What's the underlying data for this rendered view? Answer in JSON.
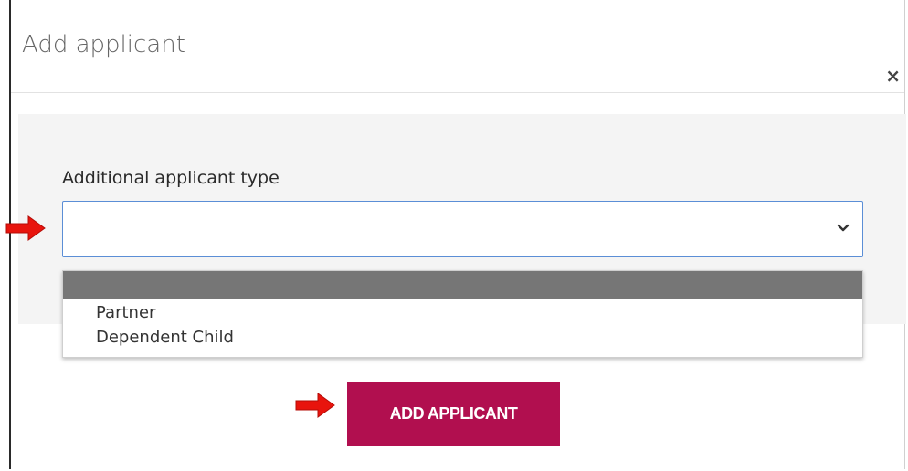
{
  "modal": {
    "title": "Add applicant",
    "close_symbol": "×"
  },
  "form": {
    "field_label": "Additional applicant type",
    "selected_value": "",
    "options": [
      {
        "label": "",
        "highlighted": true
      },
      {
        "label": "Partner",
        "highlighted": false
      },
      {
        "label": "Dependent Child",
        "highlighted": false
      }
    ]
  },
  "actions": {
    "add_label": "ADD APPLICANT"
  },
  "annotations": {
    "arrow_icon": "red-arrow-right-icon"
  },
  "colors": {
    "primary_button": "#b10f4f",
    "select_border": "#5b8ed6",
    "highlight_option": "#767676",
    "panel_bg": "#f4f4f4",
    "annotation_arrow": "#e8140d"
  }
}
